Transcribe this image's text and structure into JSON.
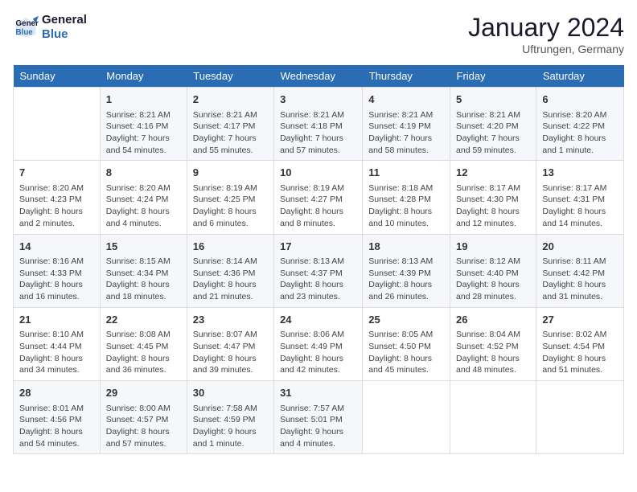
{
  "logo": {
    "line1": "General",
    "line2": "Blue"
  },
  "title": "January 2024",
  "location": "Uftrungen, Germany",
  "headers": [
    "Sunday",
    "Monday",
    "Tuesday",
    "Wednesday",
    "Thursday",
    "Friday",
    "Saturday"
  ],
  "weeks": [
    [
      {
        "num": "",
        "info": ""
      },
      {
        "num": "1",
        "info": "Sunrise: 8:21 AM\nSunset: 4:16 PM\nDaylight: 7 hours\nand 54 minutes."
      },
      {
        "num": "2",
        "info": "Sunrise: 8:21 AM\nSunset: 4:17 PM\nDaylight: 7 hours\nand 55 minutes."
      },
      {
        "num": "3",
        "info": "Sunrise: 8:21 AM\nSunset: 4:18 PM\nDaylight: 7 hours\nand 57 minutes."
      },
      {
        "num": "4",
        "info": "Sunrise: 8:21 AM\nSunset: 4:19 PM\nDaylight: 7 hours\nand 58 minutes."
      },
      {
        "num": "5",
        "info": "Sunrise: 8:21 AM\nSunset: 4:20 PM\nDaylight: 7 hours\nand 59 minutes."
      },
      {
        "num": "6",
        "info": "Sunrise: 8:20 AM\nSunset: 4:22 PM\nDaylight: 8 hours\nand 1 minute."
      }
    ],
    [
      {
        "num": "7",
        "info": "Sunrise: 8:20 AM\nSunset: 4:23 PM\nDaylight: 8 hours\nand 2 minutes."
      },
      {
        "num": "8",
        "info": "Sunrise: 8:20 AM\nSunset: 4:24 PM\nDaylight: 8 hours\nand 4 minutes."
      },
      {
        "num": "9",
        "info": "Sunrise: 8:19 AM\nSunset: 4:25 PM\nDaylight: 8 hours\nand 6 minutes."
      },
      {
        "num": "10",
        "info": "Sunrise: 8:19 AM\nSunset: 4:27 PM\nDaylight: 8 hours\nand 8 minutes."
      },
      {
        "num": "11",
        "info": "Sunrise: 8:18 AM\nSunset: 4:28 PM\nDaylight: 8 hours\nand 10 minutes."
      },
      {
        "num": "12",
        "info": "Sunrise: 8:17 AM\nSunset: 4:30 PM\nDaylight: 8 hours\nand 12 minutes."
      },
      {
        "num": "13",
        "info": "Sunrise: 8:17 AM\nSunset: 4:31 PM\nDaylight: 8 hours\nand 14 minutes."
      }
    ],
    [
      {
        "num": "14",
        "info": "Sunrise: 8:16 AM\nSunset: 4:33 PM\nDaylight: 8 hours\nand 16 minutes."
      },
      {
        "num": "15",
        "info": "Sunrise: 8:15 AM\nSunset: 4:34 PM\nDaylight: 8 hours\nand 18 minutes."
      },
      {
        "num": "16",
        "info": "Sunrise: 8:14 AM\nSunset: 4:36 PM\nDaylight: 8 hours\nand 21 minutes."
      },
      {
        "num": "17",
        "info": "Sunrise: 8:13 AM\nSunset: 4:37 PM\nDaylight: 8 hours\nand 23 minutes."
      },
      {
        "num": "18",
        "info": "Sunrise: 8:13 AM\nSunset: 4:39 PM\nDaylight: 8 hours\nand 26 minutes."
      },
      {
        "num": "19",
        "info": "Sunrise: 8:12 AM\nSunset: 4:40 PM\nDaylight: 8 hours\nand 28 minutes."
      },
      {
        "num": "20",
        "info": "Sunrise: 8:11 AM\nSunset: 4:42 PM\nDaylight: 8 hours\nand 31 minutes."
      }
    ],
    [
      {
        "num": "21",
        "info": "Sunrise: 8:10 AM\nSunset: 4:44 PM\nDaylight: 8 hours\nand 34 minutes."
      },
      {
        "num": "22",
        "info": "Sunrise: 8:08 AM\nSunset: 4:45 PM\nDaylight: 8 hours\nand 36 minutes."
      },
      {
        "num": "23",
        "info": "Sunrise: 8:07 AM\nSunset: 4:47 PM\nDaylight: 8 hours\nand 39 minutes."
      },
      {
        "num": "24",
        "info": "Sunrise: 8:06 AM\nSunset: 4:49 PM\nDaylight: 8 hours\nand 42 minutes."
      },
      {
        "num": "25",
        "info": "Sunrise: 8:05 AM\nSunset: 4:50 PM\nDaylight: 8 hours\nand 45 minutes."
      },
      {
        "num": "26",
        "info": "Sunrise: 8:04 AM\nSunset: 4:52 PM\nDaylight: 8 hours\nand 48 minutes."
      },
      {
        "num": "27",
        "info": "Sunrise: 8:02 AM\nSunset: 4:54 PM\nDaylight: 8 hours\nand 51 minutes."
      }
    ],
    [
      {
        "num": "28",
        "info": "Sunrise: 8:01 AM\nSunset: 4:56 PM\nDaylight: 8 hours\nand 54 minutes."
      },
      {
        "num": "29",
        "info": "Sunrise: 8:00 AM\nSunset: 4:57 PM\nDaylight: 8 hours\nand 57 minutes."
      },
      {
        "num": "30",
        "info": "Sunrise: 7:58 AM\nSunset: 4:59 PM\nDaylight: 9 hours\nand 1 minute."
      },
      {
        "num": "31",
        "info": "Sunrise: 7:57 AM\nSunset: 5:01 PM\nDaylight: 9 hours\nand 4 minutes."
      },
      {
        "num": "",
        "info": ""
      },
      {
        "num": "",
        "info": ""
      },
      {
        "num": "",
        "info": ""
      }
    ]
  ]
}
